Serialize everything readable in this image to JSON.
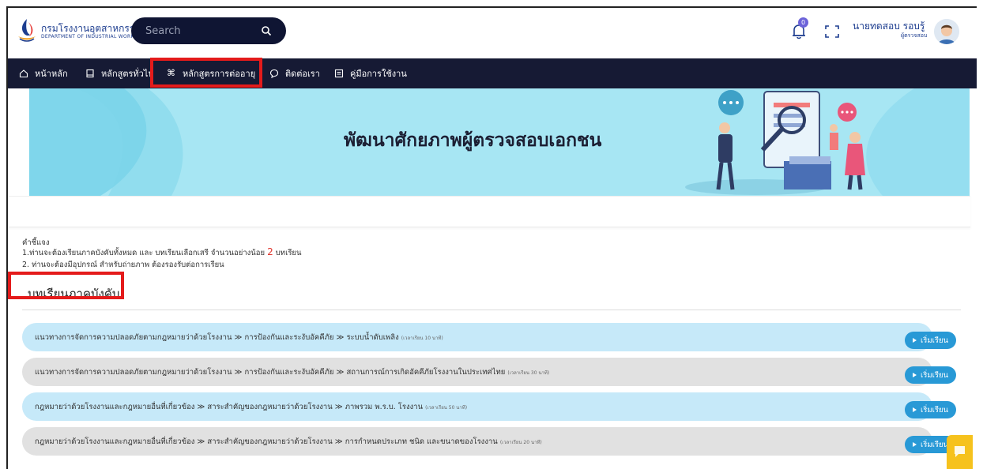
{
  "header": {
    "logo_th": "กรมโรงงานอุตสาหกรรม",
    "logo_en": "DEPARTMENT OF INDUSTRIAL WORKS",
    "search_placeholder": "Search",
    "notification_count": "0",
    "user_name": "นายทดสอบ รอบรู้",
    "user_role": "ผู้ตรวจสอบ"
  },
  "nav": {
    "items": [
      {
        "label": "หน้าหลัก",
        "icon": "home-icon"
      },
      {
        "label": "หลักสูตรทั่วไป",
        "icon": "book-icon"
      },
      {
        "label": "หลักสูตรการต่ออายุ",
        "icon": "command-icon"
      },
      {
        "label": "ติดต่อเรา",
        "icon": "chat-icon"
      },
      {
        "label": "คู่มือการใช้งาน",
        "icon": "manual-icon"
      }
    ]
  },
  "banner": {
    "title": "พัฒนาศักยภาพผู้ตรวจสอบเอกชน"
  },
  "instructions": {
    "heading": "คำชี้แจง",
    "line1_prefix": "1.ท่านจะต้องเรียนภาคบังคับทั้งหมด และ บทเรียนเลือกเสรี จำนวนอย่างน้อย",
    "line1_number": "2",
    "line1_suffix": "บทเรียน",
    "line2": "2. ท่านจะต้องมีอุปกรณ์ สำหรับถ่ายภาพ ต้องรองรับต่อการเรียน"
  },
  "section": {
    "title": "บทเรียนภาคบังคับ"
  },
  "lessons": [
    {
      "path": "แนวทางการจัดการความปลอดภัยตามกฎหมายว่าด้วยโรงงาน ≫ การป้องกันและระงับอัคคีภัย ≫ ระบบน้ำดับเพลิง",
      "duration": "(เวลาเรียน 10 นาที)",
      "button": "เริ่มเรียน"
    },
    {
      "path": "แนวทางการจัดการความปลอดภัยตามกฎหมายว่าด้วยโรงงาน ≫ การป้องกันและระงับอัคคีภัย ≫ สถานการณ์การเกิดอัคคีภัยโรงงานในประเทศไทย",
      "duration": "(เวลาเรียน 30 นาที)",
      "button": "เริ่มเรียน"
    },
    {
      "path": "กฎหมายว่าด้วยโรงงานและกฎหมายอื่นที่เกี่ยวข้อง ≫ สาระสำคัญของกฎหมายว่าด้วยโรงงาน ≫ ภาพรวม พ.ร.บ. โรงงาน",
      "duration": "(เวลาเรียน 50 นาที)",
      "button": "เริ่มเรียน"
    },
    {
      "path": "กฎหมายว่าด้วยโรงงานและกฎหมายอื่นที่เกี่ยวข้อง ≫ สาระสำคัญของกฎหมายว่าด้วยโรงงาน ≫ การกำหนดประเภท ชนิด และขนาดของโรงงาน",
      "duration": "(เวลาเรียน 20 นาที)",
      "button": "เริ่มเรียน"
    }
  ],
  "colors": {
    "navbar": "#161a34",
    "search_bg": "#0f1533",
    "banner": "#a7e6f3",
    "highlight": "#e41b1b",
    "start_button": "#2899d6",
    "row_blue": "#c6e9f9",
    "row_gray": "#e1e1e1",
    "chat_fab": "#f6c21d"
  }
}
